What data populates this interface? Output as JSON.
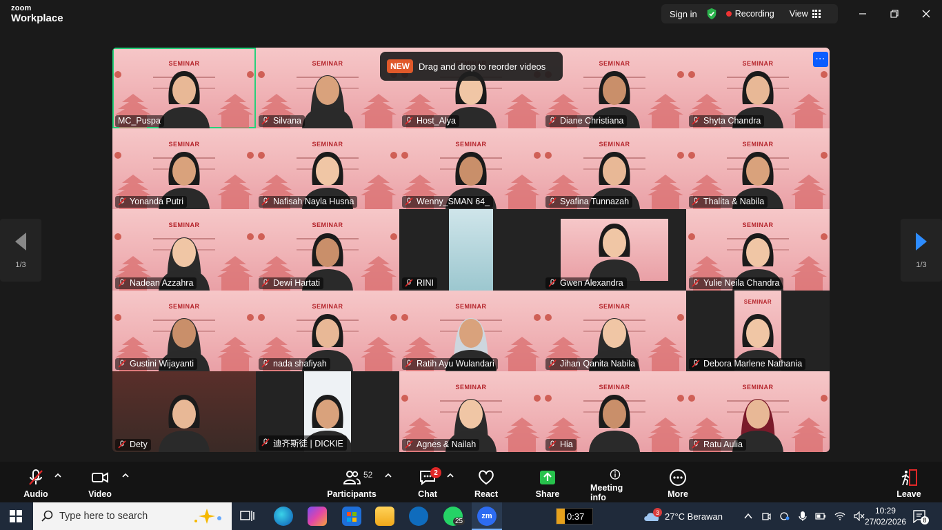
{
  "app": {
    "brand_small": "zoom",
    "brand_large": "Workplace",
    "sign_in": "Sign in",
    "recording": "Recording",
    "view": "View"
  },
  "toast": {
    "badge": "NEW",
    "text": "Drag and drop to reorder videos"
  },
  "pager": {
    "left_label": "1/3",
    "right_label": "1/3"
  },
  "tiles": [
    {
      "name": "MC_Puspa"
    },
    {
      "name": "Silvana"
    },
    {
      "name": "Host_Alya"
    },
    {
      "name": "Diane Christiana"
    },
    {
      "name": "Shyta Chandra"
    },
    {
      "name": "Yonanda Putri"
    },
    {
      "name": "Nafisah Nayla Husna"
    },
    {
      "name": "Wenny_SMAN 64_"
    },
    {
      "name": "Syafina Tunnazah"
    },
    {
      "name": "Thalita & Nabila"
    },
    {
      "name": "Nadean Azzahra"
    },
    {
      "name": "Dewi Hartati"
    },
    {
      "name": "RINI"
    },
    {
      "name": "Gwen Alexandra"
    },
    {
      "name": "Yulie Neila Chandra"
    },
    {
      "name": "Gustini Wijayanti"
    },
    {
      "name": "nada shafiyah"
    },
    {
      "name": "Ratih Ayu Wulandari"
    },
    {
      "name": "Jihan Qanita Nabila"
    },
    {
      "name": "Debora Marlene Nathania"
    },
    {
      "name": "Dety"
    },
    {
      "name": "迪齐斯徒 | DICKIE"
    },
    {
      "name": "Agnes & Nailah"
    },
    {
      "name": "Hia"
    },
    {
      "name": "Ratu Aulia"
    }
  ],
  "seminar_label": "SEMINAR",
  "toolbar": {
    "audio": "Audio",
    "video": "Video",
    "participants": "Participants",
    "participants_count": "52",
    "chat": "Chat",
    "chat_badge": "2",
    "react": "React",
    "share": "Share",
    "meeting_info": "Meeting info",
    "more": "More",
    "leave": "Leave"
  },
  "taskbar": {
    "search_placeholder": "Type here to search",
    "whatsapp_badge": "25",
    "media_time": "0:37",
    "weather_badge": "3",
    "weather": "27°C  Berawan",
    "time": "10:29",
    "date": "27/02/2026",
    "notif_count": "8"
  },
  "colors": {
    "accent": "#0b5cff",
    "active_border": "#27d07a",
    "recording": "#e33333",
    "share": "#27c24c"
  }
}
